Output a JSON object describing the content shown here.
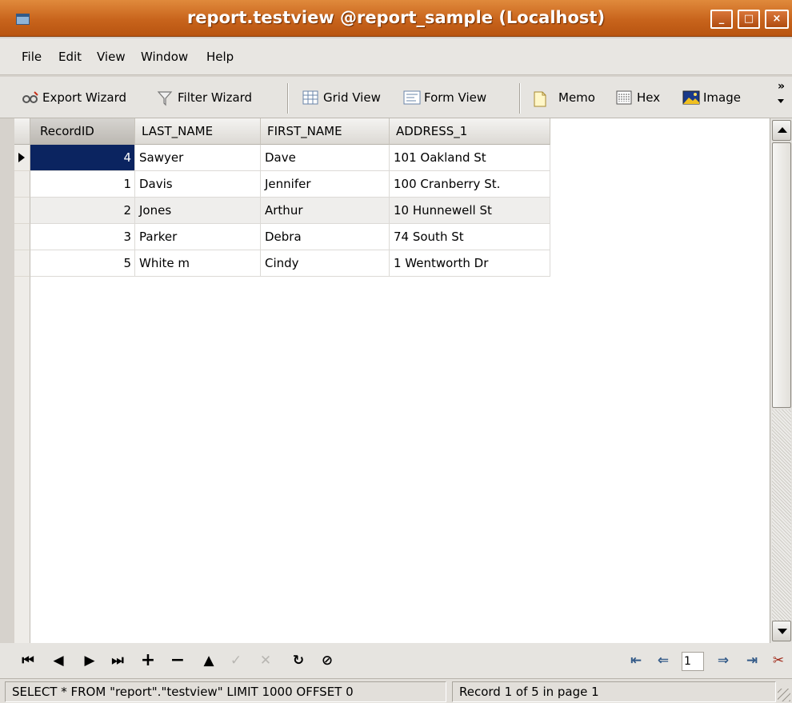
{
  "window": {
    "title": "report.testview @report_sample (Localhost)",
    "minimize_glyph": "_",
    "maximize_glyph": "□",
    "close_glyph": "×"
  },
  "menu": [
    "File",
    "Edit",
    "View",
    "Window",
    "Help"
  ],
  "toolbar": {
    "export_wizard": "Export Wizard",
    "filter_wizard": "Filter Wizard",
    "grid_view": "Grid View",
    "form_view": "Form View",
    "memo": "Memo",
    "hex": "Hex",
    "image": "Image",
    "overflow": "»"
  },
  "grid": {
    "columns": [
      "RecordID",
      "LAST_NAME",
      "FIRST_NAME",
      "ADDRESS_1"
    ],
    "rows": [
      [
        "4",
        "Sawyer",
        "Dave",
        "101 Oakland St"
      ],
      [
        "1",
        "Davis",
        "Jennifer",
        "100 Cranberry St."
      ],
      [
        "2",
        "Jones",
        "Arthur",
        "10 Hunnewell St"
      ],
      [
        "3",
        "Parker",
        "Debra",
        "74 South St"
      ],
      [
        "5",
        "White m",
        "Cindy",
        "1 Wentworth Dr"
      ]
    ],
    "selected_row": 0,
    "sorted_column": "RecordID"
  },
  "navigator": {
    "first": "⏮",
    "prior": "◀",
    "next": "▶",
    "last": "⏭",
    "insert": "+",
    "delete": "−",
    "edit": "▲",
    "post": "✓",
    "cancel": "✕",
    "refresh": "↻",
    "stop": "⊘",
    "page_first": "⇤",
    "page_prior": "⇐",
    "page_value": "1",
    "page_next": "⇒",
    "page_last": "⇥",
    "tools": "✂"
  },
  "status": {
    "query": "SELECT * FROM \"report\".\"testview\" LIMIT 1000 OFFSET 0",
    "record": "Record 1 of 5 in page 1"
  },
  "colors": {
    "titlebar": "#c8641c",
    "selection": "#0b2460"
  }
}
